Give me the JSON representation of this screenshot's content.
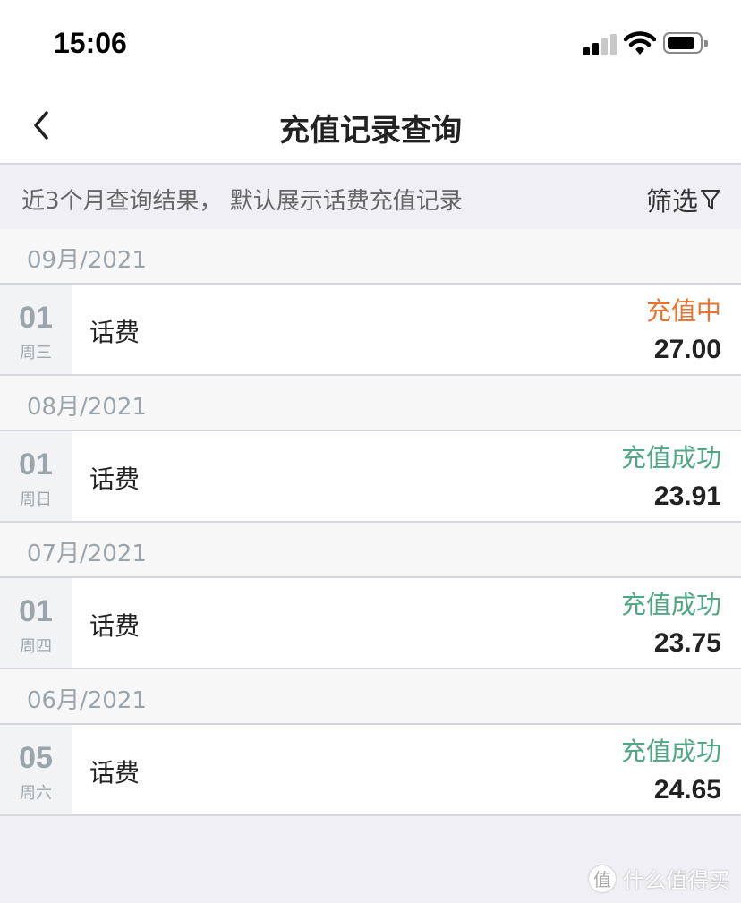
{
  "status_bar": {
    "time": "15:06"
  },
  "nav": {
    "title": "充值记录查询"
  },
  "filter": {
    "summary": "近3个月查询结果， 默认展示话费充值记录",
    "button_label": "筛选"
  },
  "colors": {
    "pending": "#e8732e",
    "success": "#4fa882"
  },
  "groups": [
    {
      "month": "09月/2021",
      "records": [
        {
          "day": "01",
          "weekday": "周三",
          "name": "话费",
          "status": "充值中",
          "status_type": "pending",
          "amount": "27.00"
        }
      ]
    },
    {
      "month": "08月/2021",
      "records": [
        {
          "day": "01",
          "weekday": "周日",
          "name": "话费",
          "status": "充值成功",
          "status_type": "success",
          "amount": "23.91"
        }
      ]
    },
    {
      "month": "07月/2021",
      "records": [
        {
          "day": "01",
          "weekday": "周四",
          "name": "话费",
          "status": "充值成功",
          "status_type": "success",
          "amount": "23.75"
        }
      ]
    },
    {
      "month": "06月/2021",
      "records": [
        {
          "day": "05",
          "weekday": "周六",
          "name": "话费",
          "status": "充值成功",
          "status_type": "success",
          "amount": "24.65"
        }
      ]
    }
  ],
  "watermark": {
    "logo": "值",
    "text": "什么值得买"
  }
}
